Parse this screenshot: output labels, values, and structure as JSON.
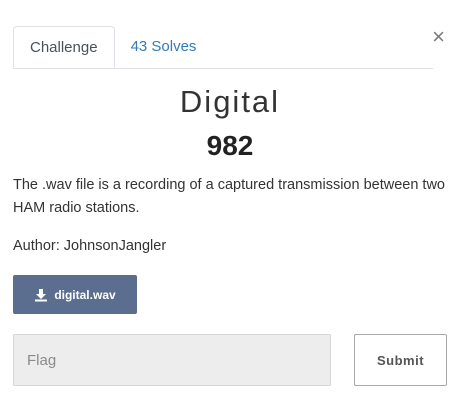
{
  "tabs": [
    {
      "label": "Challenge",
      "active": true
    },
    {
      "label": "43 Solves",
      "active": false
    }
  ],
  "close_symbol": "×",
  "challenge": {
    "name": "Digital",
    "value": "982",
    "description": "The .wav file is a recording of a captured transmission between two HAM radio stations.",
    "author": "Author: JohnsonJangler"
  },
  "file": {
    "label": "digital.wav",
    "icon": "download-icon"
  },
  "flag_input": {
    "placeholder": "Flag",
    "value": ""
  },
  "submit_label": "Submit",
  "colors": {
    "file_button": "#5b6e8f",
    "tab_link": "#337ab7"
  }
}
